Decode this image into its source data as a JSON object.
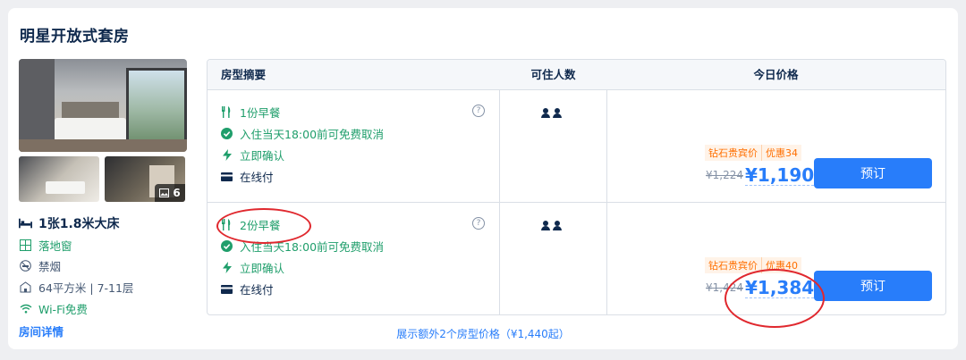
{
  "room": {
    "title": "明星开放式套房",
    "photo_count": "6",
    "bed": "1张1.8米大床",
    "amenities": [
      "落地窗",
      "禁烟",
      "64平方米 | 7-11层",
      "Wi-Fi免费"
    ],
    "detail_link": "房间详情"
  },
  "table": {
    "headers": {
      "summary": "房型摘要",
      "guests": "可住人数",
      "price": "今日价格"
    },
    "rows": [
      {
        "breakfast": "1份早餐",
        "cancel": "入住当天18:00前可免费取消",
        "confirm": "立即确认",
        "payment": "在线付",
        "badge_member": "钻石贵宾价",
        "badge_discount": "优惠34",
        "original_price": "¥1,224",
        "price": "¥1,190",
        "book_label": "预订"
      },
      {
        "breakfast": "2份早餐",
        "cancel": "入住当天18:00前可免费取消",
        "confirm": "立即确认",
        "payment": "在线付",
        "badge_member": "钻石贵宾价",
        "badge_discount": "优惠40",
        "original_price": "¥1,424",
        "price": "¥1,384",
        "book_label": "预订"
      }
    ]
  },
  "more_prices": "展示额外2个房型价格（¥1,440起）",
  "colors": {
    "accent": "#287dfa",
    "green": "#1f9e6b",
    "badge": "#ff6f00",
    "annotation": "#e0282e"
  }
}
